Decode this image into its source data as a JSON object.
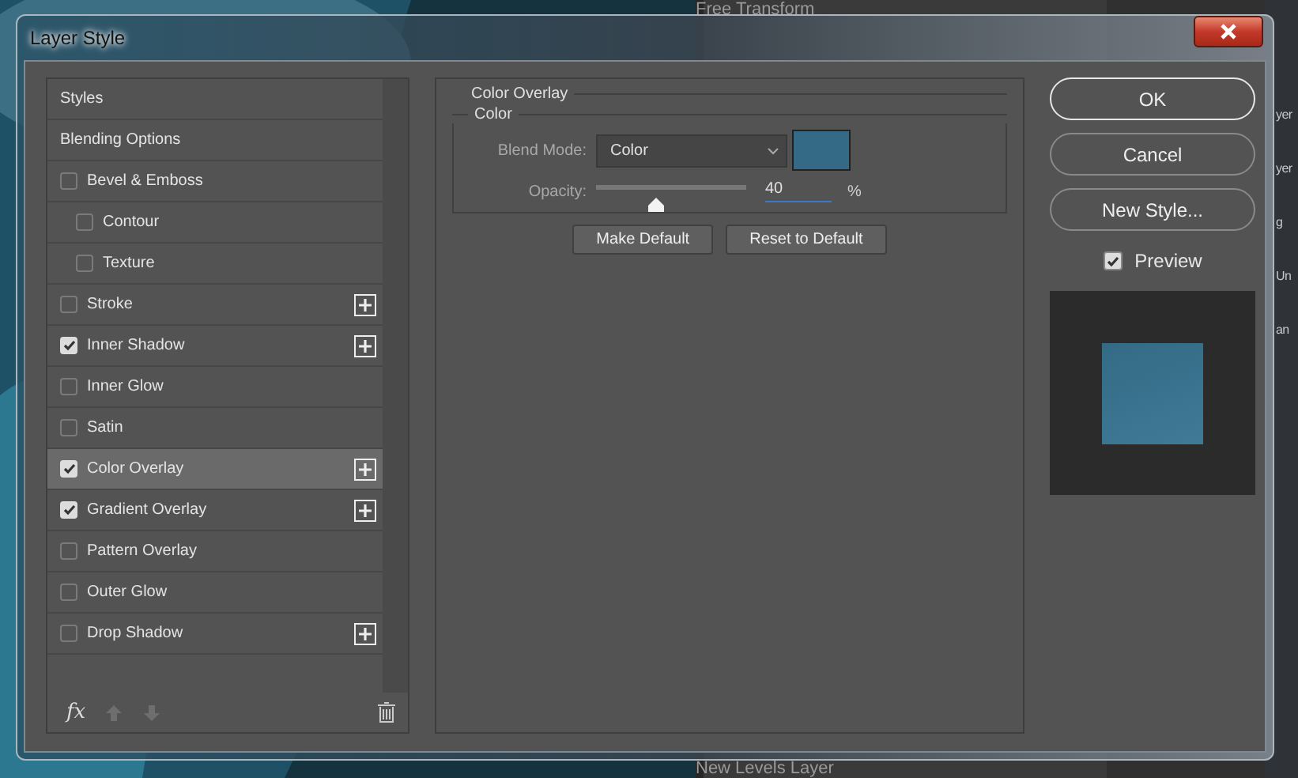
{
  "backdrop": {
    "panel_items": [
      "Free Transform",
      "New Levels Layer"
    ],
    "edge_texts": [
      "yer",
      "yer",
      "g",
      "Un",
      "an"
    ]
  },
  "window": {
    "title": "Layer Style"
  },
  "styles_list": [
    {
      "label": "Styles",
      "kind": "header",
      "selected": false
    },
    {
      "label": "Blending Options",
      "kind": "header",
      "selected": false
    },
    {
      "label": "Bevel & Emboss",
      "kind": "effect",
      "checked": false,
      "selected": false,
      "addable": false,
      "children": [
        {
          "label": "Contour",
          "kind": "effect",
          "checked": false,
          "selected": false,
          "addable": false
        },
        {
          "label": "Texture",
          "kind": "effect",
          "checked": false,
          "selected": false,
          "addable": false
        }
      ]
    },
    {
      "label": "Stroke",
      "kind": "effect",
      "checked": false,
      "selected": false,
      "addable": true
    },
    {
      "label": "Inner Shadow",
      "kind": "effect",
      "checked": true,
      "selected": false,
      "addable": true
    },
    {
      "label": "Inner Glow",
      "kind": "effect",
      "checked": false,
      "selected": false,
      "addable": false
    },
    {
      "label": "Satin",
      "kind": "effect",
      "checked": false,
      "selected": false,
      "addable": false
    },
    {
      "label": "Color Overlay",
      "kind": "effect",
      "checked": true,
      "selected": true,
      "addable": true
    },
    {
      "label": "Gradient Overlay",
      "kind": "effect",
      "checked": true,
      "selected": false,
      "addable": true
    },
    {
      "label": "Pattern Overlay",
      "kind": "effect",
      "checked": false,
      "selected": false,
      "addable": false
    },
    {
      "label": "Outer Glow",
      "kind": "effect",
      "checked": false,
      "selected": false,
      "addable": false
    },
    {
      "label": "Drop Shadow",
      "kind": "effect",
      "checked": false,
      "selected": false,
      "addable": true
    }
  ],
  "list_footer": {
    "fx_label": "fx"
  },
  "settings": {
    "title": "Color Overlay",
    "group": "Color",
    "blend_mode": {
      "label": "Blend Mode:",
      "value": "Color"
    },
    "swatch": {
      "color": "#346a86"
    },
    "opacity": {
      "label": "Opacity:",
      "level": 0.4,
      "value": "40",
      "unit": "%"
    },
    "buttons": [
      "Make Default",
      "Reset to Default"
    ]
  },
  "actions": [
    {
      "label": "OK",
      "default": true
    },
    {
      "label": "Cancel",
      "default": false
    },
    {
      "label": "New Style...",
      "default": false
    }
  ],
  "preview": {
    "label": "Preview",
    "checked": true
  }
}
